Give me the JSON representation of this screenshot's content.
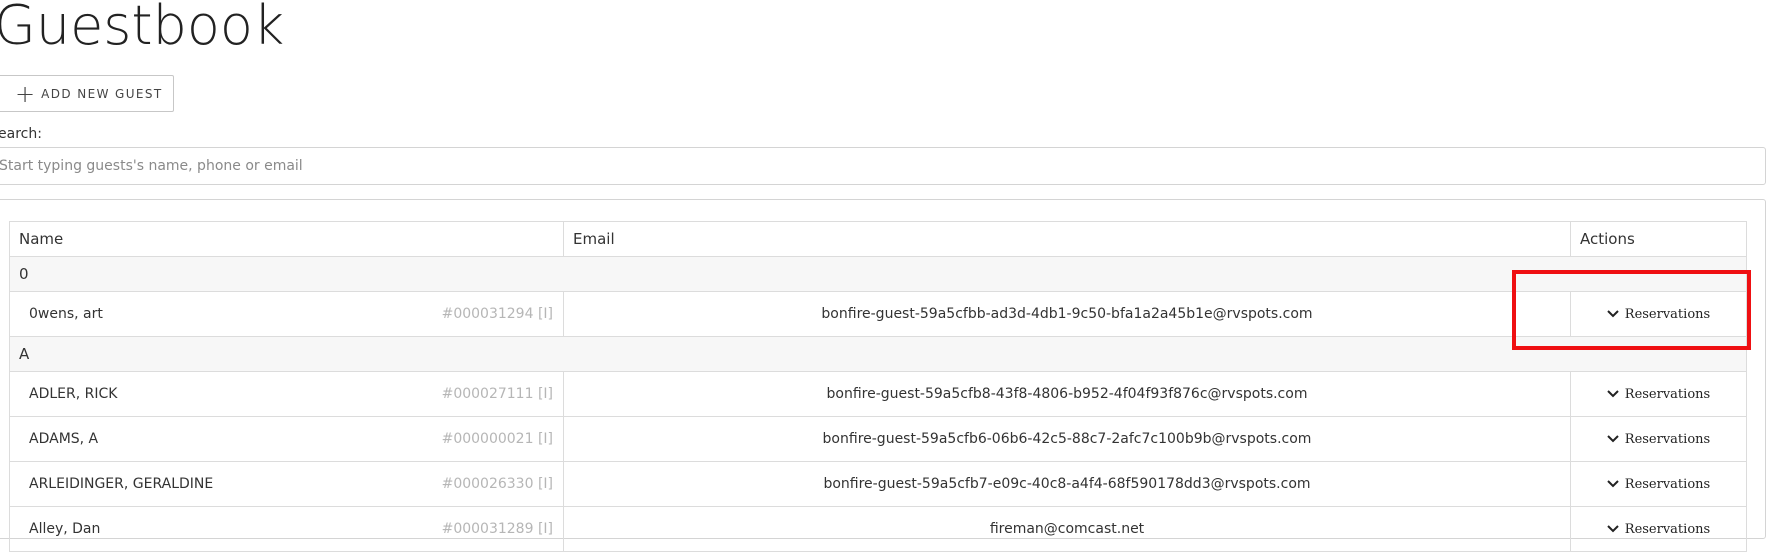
{
  "page": {
    "title": "Guestbook"
  },
  "toolbar": {
    "add_guest_label": "ADD NEW GUEST"
  },
  "search": {
    "label": "earch:",
    "placeholder": "Start typing guests's name, phone or email",
    "value": ""
  },
  "table": {
    "headers": {
      "name": "Name",
      "email": "Email",
      "actions": "Actions"
    },
    "groups": [
      {
        "letter": "0",
        "rows": [
          {
            "name": "0wens, art",
            "id": "#000031294 [I]",
            "email": "bonfire-guest-59a5cfbb-ad3d-4db1-9c50-bfa1a2a45b1e@rvspots.com",
            "action": "Reservations"
          }
        ]
      },
      {
        "letter": "A",
        "rows": [
          {
            "name": "ADLER, RICK",
            "id": "#000027111 [I]",
            "email": "bonfire-guest-59a5cfb8-43f8-4806-b952-4f04f93f876c@rvspots.com",
            "action": "Reservations"
          },
          {
            "name": "ADAMS, A",
            "id": "#000000021 [I]",
            "email": "bonfire-guest-59a5cfb6-06b6-42c5-88c7-2afc7c100b9b@rvspots.com",
            "action": "Reservations"
          },
          {
            "name": "ARLEIDINGER, GERALDINE",
            "id": "#000026330 [I]",
            "email": "bonfire-guest-59a5cfb7-e09c-40c8-a4f4-68f590178dd3@rvspots.com",
            "action": "Reservations"
          },
          {
            "name": "Alley, Dan",
            "id": "#000031289 [I]",
            "email": "fireman@comcast.net",
            "action": "Reservations"
          }
        ]
      }
    ]
  },
  "colors": {
    "highlight": "#ef0f12"
  }
}
